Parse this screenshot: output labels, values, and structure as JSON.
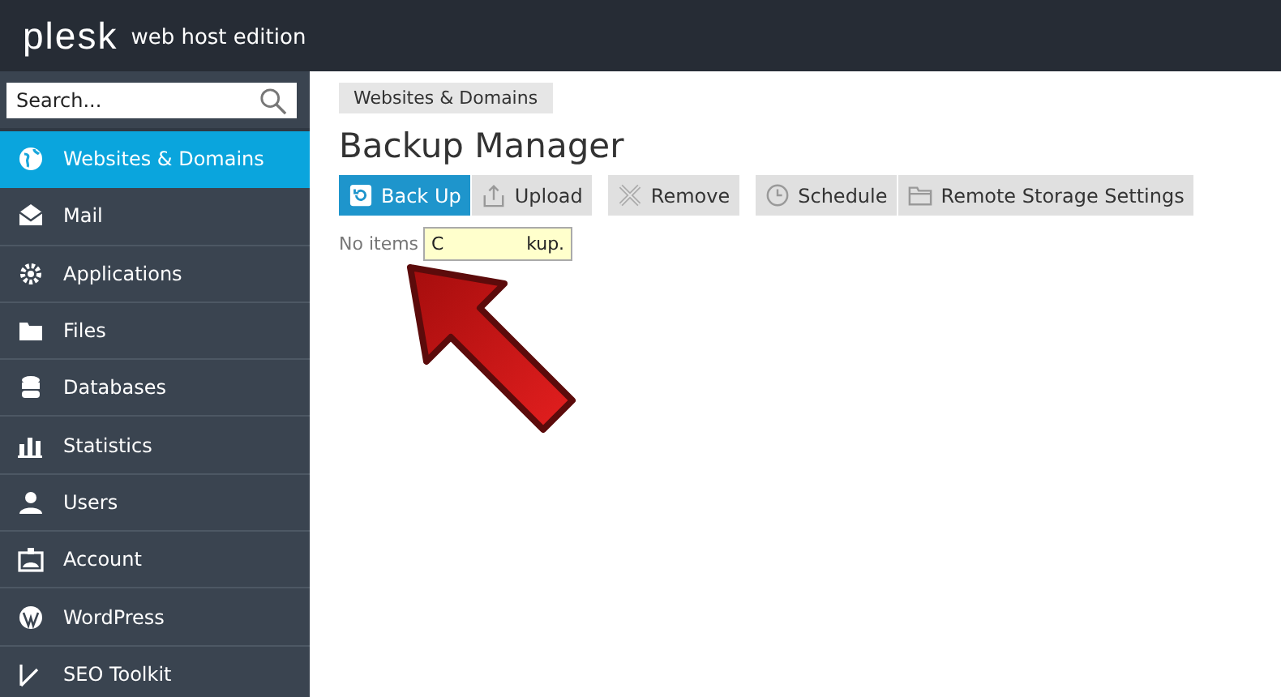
{
  "header": {
    "logo": "plesk",
    "edition": "web host edition"
  },
  "sidebar": {
    "search": {
      "placeholder": "Search..."
    },
    "items": [
      {
        "label": "Websites & Domains",
        "selected": true
      },
      {
        "label": "Mail",
        "selected": false
      },
      {
        "label": "Applications",
        "selected": false
      },
      {
        "label": "Files",
        "selected": false
      },
      {
        "label": "Databases",
        "selected": false
      },
      {
        "label": "Statistics",
        "selected": false
      },
      {
        "label": "Users",
        "selected": false
      },
      {
        "label": "Account",
        "selected": false
      },
      {
        "label": "WordPress",
        "selected": false
      },
      {
        "label": "SEO Toolkit",
        "selected": false
      }
    ]
  },
  "breadcrumb": [
    "Websites & Domains"
  ],
  "title": "Backup Manager",
  "toolbar": [
    [
      {
        "label": "Back Up",
        "highlighted": true
      },
      {
        "label": "Upload",
        "highlighted": false
      }
    ],
    [
      {
        "label": "Remove",
        "highlighted": false
      }
    ],
    [
      {
        "label": "Schedule",
        "highlighted": false
      },
      {
        "label": "Remote Storage Settings",
        "highlighted": false
      }
    ]
  ],
  "empty_message": "No items",
  "tooltip": {
    "text_start": "C",
    "text_end": "kup."
  }
}
